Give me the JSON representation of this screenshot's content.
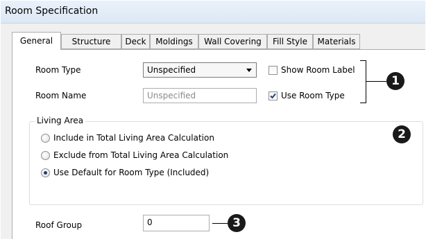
{
  "window": {
    "title": "Room Specification"
  },
  "tabs": [
    {
      "label": "General",
      "active": true
    },
    {
      "label": "Structure",
      "active": false
    },
    {
      "label": "Deck",
      "active": false
    },
    {
      "label": "Moldings",
      "active": false
    },
    {
      "label": "Wall Covering",
      "active": false
    },
    {
      "label": "Fill Style",
      "active": false
    },
    {
      "label": "Materials",
      "active": false
    }
  ],
  "general": {
    "room_type_label": "Room Type",
    "room_type_value": "Unspecified",
    "room_name_label": "Room Name",
    "room_name_placeholder": "Unspecified",
    "show_room_label": "Show Room Label",
    "show_room_label_checked": false,
    "use_room_type": "Use Room Type",
    "use_room_type_checked": true
  },
  "living_area": {
    "label": "Living Area",
    "options": [
      {
        "label": "Include in Total Living Area Calculation",
        "selected": false
      },
      {
        "label": "Exclude from Total Living Area Calculation",
        "selected": false
      },
      {
        "label": "Use Default for Room Type (Included)",
        "selected": true
      }
    ]
  },
  "roof_group": {
    "label": "Roof Group",
    "value": "0"
  },
  "callouts": [
    "1",
    "2",
    "3"
  ],
  "colors": {
    "accent": "#1f3f73",
    "callout": "#1a1a1a",
    "titlebar": "#dde8f5"
  }
}
